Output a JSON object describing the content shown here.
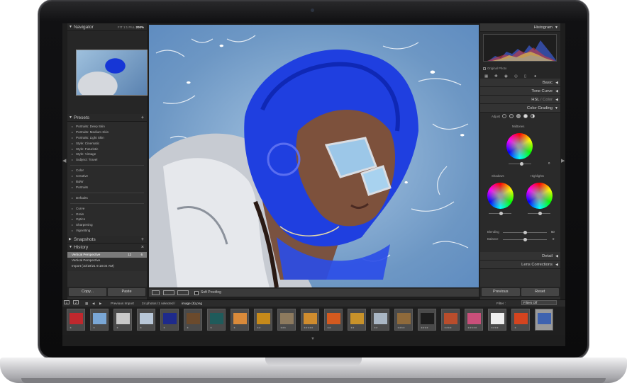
{
  "navigator": {
    "title": "Navigator",
    "zoom_fit": "FIT",
    "zoom_1": "1:1",
    "zoom_fill": "FILL",
    "zoom_current": "200%"
  },
  "presets": {
    "title": "Presets",
    "group1": [
      "Portraits: Deep Skin",
      "Portraits: Medium Skin",
      "Portraits: Light Skin",
      "Style: Cinematic",
      "Style: Futuristic",
      "Style: Vintage",
      "Subject: Travel"
    ],
    "group2": [
      "Color",
      "Creative",
      "B&W",
      "Portraits"
    ],
    "group3": [
      "Defaults"
    ],
    "group4": [
      "Curve",
      "Grain",
      "Optics",
      "Sharpening",
      "Vignetting"
    ]
  },
  "snapshots": {
    "title": "Snapshots"
  },
  "history": {
    "title": "History",
    "items": [
      {
        "label": "Vertical Perspective",
        "v1": "12",
        "v2": "6"
      },
      {
        "label": "Vertical Perspective",
        "v1": "",
        "v2": ""
      },
      {
        "label": "Import (10/19/21 9:18:04 AM)",
        "v1": "",
        "v2": ""
      }
    ]
  },
  "left_buttons": {
    "copy": "Copy...",
    "paste": "Paste"
  },
  "toolbar": {
    "soft_proofing": "Soft Proofing"
  },
  "right_panel": {
    "histogram": "Histogram",
    "original_photo": "Original Photo",
    "basic": "Basic",
    "tone_curve": "Tone Curve",
    "hsl": "HSL",
    "hsl_sep": " / ",
    "color": "Color",
    "color_grading": "Color Grading",
    "adjust": "Adjust",
    "midtones": "Midtones",
    "shadows": "Shadows",
    "highlights": "Highlights",
    "blending": "Blending",
    "blending_value": "50",
    "balance": "Balance",
    "balance_value": "0",
    "midtones_lum_value": "0",
    "detail": "Detail",
    "lens_corrections": "Lens Corrections"
  },
  "right_buttons": {
    "previous": "Previous",
    "reset": "Reset"
  },
  "filmstrip": {
    "page1": "1",
    "page2": "2",
    "source": "Previous Import",
    "count_text": "24 photos /1 selected /",
    "file": "image (5).png",
    "filter_label": "Filter :",
    "filter_value": "Filters Off"
  },
  "thumbs": [
    {
      "color": "#c0282d",
      "stars": "★"
    },
    {
      "color": "#7aa7d6",
      "stars": "★"
    },
    {
      "color": "#c9c9c9",
      "stars": "★"
    },
    {
      "color": "#b8c7d8",
      "stars": "★"
    },
    {
      "color": "#1e2a8c",
      "stars": "★"
    },
    {
      "color": "#6b4a2c",
      "stars": "★"
    },
    {
      "color": "#1f5b5b",
      "stars": "★"
    },
    {
      "color": "#d98a3a",
      "stars": "★"
    },
    {
      "color": "#c78a1a",
      "stars": "★★"
    },
    {
      "color": "#8d7a5e",
      "stars": "★★★"
    },
    {
      "color": "#cf8c2e",
      "stars": "★★★★★"
    },
    {
      "color": "#d45a1f",
      "stars": "★★"
    },
    {
      "color": "#c8922a",
      "stars": "★★"
    },
    {
      "color": "#a9b6c4",
      "stars": "★★"
    },
    {
      "color": "#8f6a3b",
      "stars": "★★★★"
    },
    {
      "color": "#1d1d1d",
      "stars": "★★★★"
    },
    {
      "color": "#b94d2c",
      "stars": "★★★★"
    },
    {
      "color": "#c94f7a",
      "stars": "★★★★★"
    },
    {
      "color": "#efefef",
      "stars": "★★★★"
    },
    {
      "color": "#d4441f",
      "stars": "★"
    },
    {
      "color": "#3f63b0",
      "stars": "★"
    }
  ]
}
